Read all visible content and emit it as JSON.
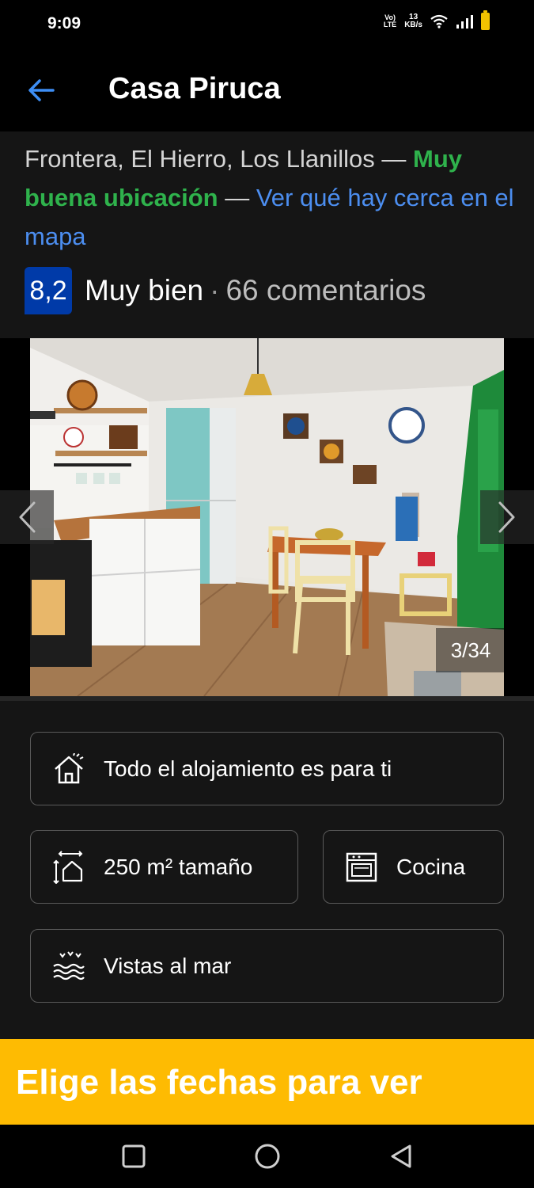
{
  "status_bar": {
    "time": "9:09",
    "volte_top": "Vo)",
    "volte_bottom": "LTE",
    "speed_value": "13",
    "speed_unit": "KB/s"
  },
  "header": {
    "title": "Casa Piruca"
  },
  "location": {
    "address": "Frontera, El Hierro, Los Llanillos",
    "separator": " — ",
    "highlight": "Muy buena ubicación",
    "map_link": "Ver qué hay cerca en el mapa"
  },
  "rating": {
    "score": "8,2",
    "label": "Muy bien",
    "dot": "·",
    "reviews": "66 comentarios"
  },
  "gallery": {
    "counter": "3/34"
  },
  "features": [
    {
      "label": "Todo el alojamiento es para ti",
      "icon": "house-icon"
    },
    {
      "label": "250 m² tamaño",
      "icon": "area-size-icon"
    },
    {
      "label": "Cocina",
      "icon": "oven-icon"
    },
    {
      "label": "Vistas al mar",
      "icon": "sea-view-icon"
    }
  ],
  "cta": {
    "text": "Elige las fechas para ver"
  },
  "colors": {
    "accent_blue": "#4c8ef0",
    "score_blue": "#003aa8",
    "good_green": "#2fb24c",
    "cta_yellow": "#febb02"
  }
}
